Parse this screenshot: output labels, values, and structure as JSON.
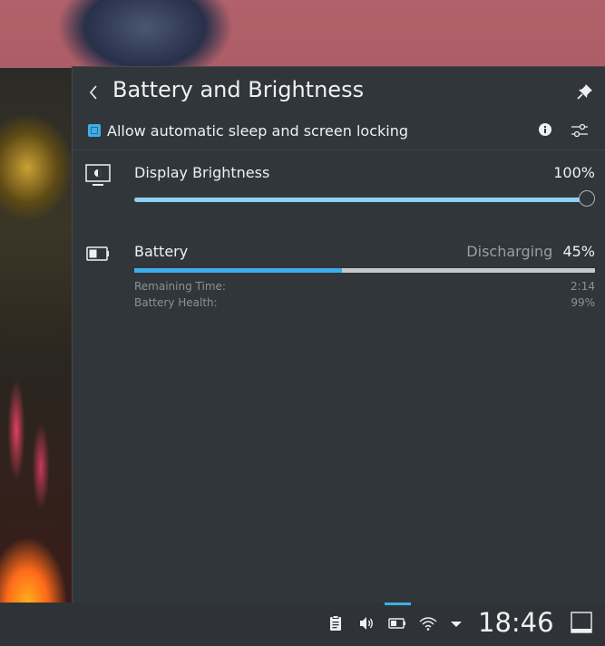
{
  "popup": {
    "title": "Battery and Brightness",
    "sleep_checkbox": {
      "label": "Allow automatic sleep and screen locking",
      "checked": true
    }
  },
  "brightness": {
    "label": "Display Brightness",
    "value_text": "100%",
    "level": 1.0
  },
  "battery": {
    "label": "Battery",
    "status": "Discharging",
    "percent_text": "45%",
    "level": 0.45,
    "details": [
      {
        "label": "Remaining Time:",
        "value": "2:14"
      },
      {
        "label": "Battery Health:",
        "value": "99%"
      }
    ]
  },
  "panel": {
    "clock": "18:46",
    "tray_icons": [
      "clipboard-icon",
      "volume-icon",
      "battery-icon",
      "wifi-icon",
      "expand-arrow-icon"
    ]
  },
  "colors": {
    "accent": "#3daee9",
    "brightness_fill": "#8fd1f2",
    "panel_bg": "#31363b"
  }
}
